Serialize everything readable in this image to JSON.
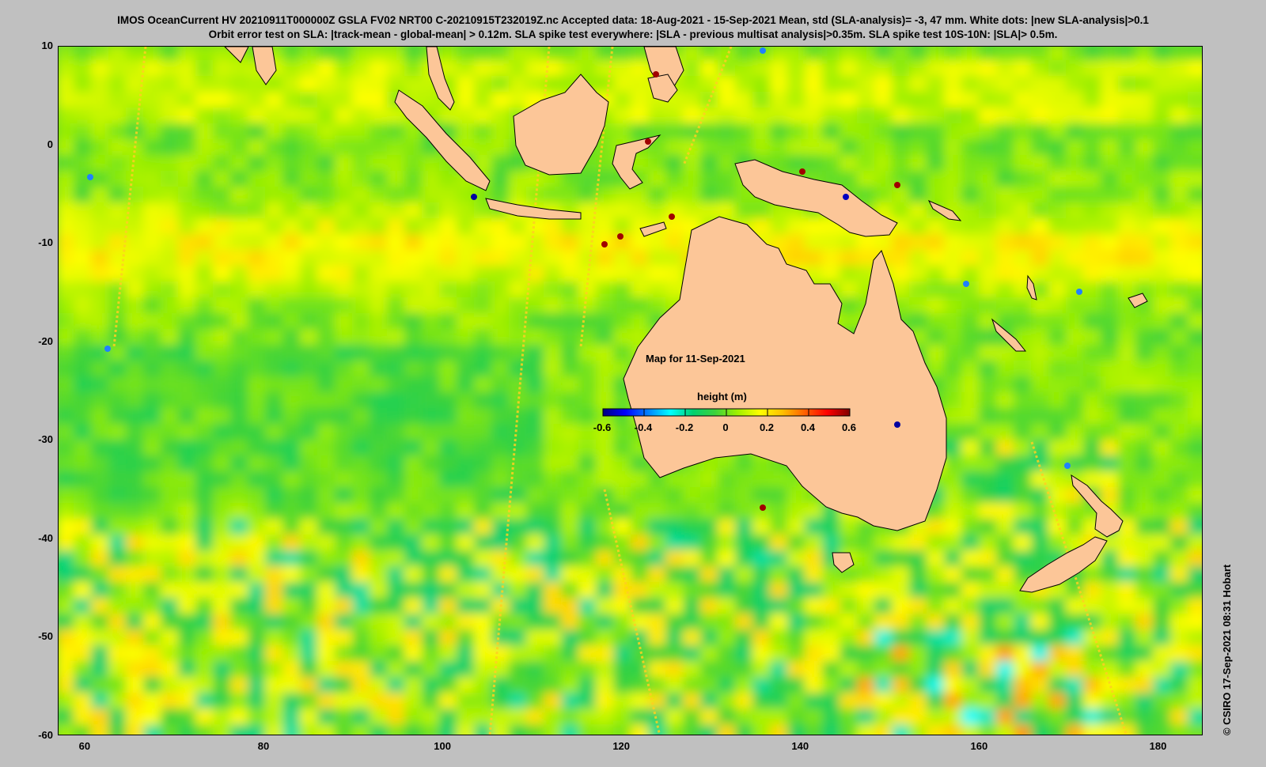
{
  "header": {
    "line1": "IMOS OceanCurrent HV 20210911T000000Z GSLA FV02 NRT00 C-20210915T232019Z.nc  Accepted data: 18-Aug-2021 - 15-Sep-2021 Mean, std (SLA-analysis)= -3, 47 mm. White dots: |new SLA-analysis|>0.1",
    "line2": "Orbit error test on SLA: |track-mean  - global-mean| > 0.12m.  SLA spike test everywhere: |SLA - previous multisat analysis|>0.35m. SLA spike test 10S-10N: |SLA|> 0.5m."
  },
  "map": {
    "date_label": "Map for 11-Sep-2021",
    "lon_range": [
      57,
      185
    ],
    "lat_range": [
      -60,
      10
    ],
    "x_ticks": [
      60,
      80,
      100,
      120,
      140,
      160,
      180
    ],
    "y_ticks": [
      10,
      0,
      -10,
      -20,
      -30,
      -40,
      -50,
      -60
    ],
    "land_color": "#fcc698",
    "ocean_base_color": "#5fd23c"
  },
  "legend": {
    "title": "height (m)",
    "range": [
      -0.6,
      0.6
    ],
    "tick_values": [
      -0.6,
      -0.4,
      -0.2,
      0,
      0.2,
      0.4,
      0.6
    ],
    "tick_labels": [
      "-0.6",
      "-0.4",
      "-0.2",
      "0",
      "0.2",
      "0.4",
      "0.6"
    ],
    "colormap": [
      "#00007f",
      "#0000ff",
      "#0080ff",
      "#00ffff",
      "#00d070",
      "#3cd23c",
      "#a0f000",
      "#ffff00",
      "#ffc000",
      "#ff6000",
      "#ff0000",
      "#7f0000"
    ]
  },
  "credit": "©  CSIRO 17-Sep-2021 08:31 Hobart"
}
